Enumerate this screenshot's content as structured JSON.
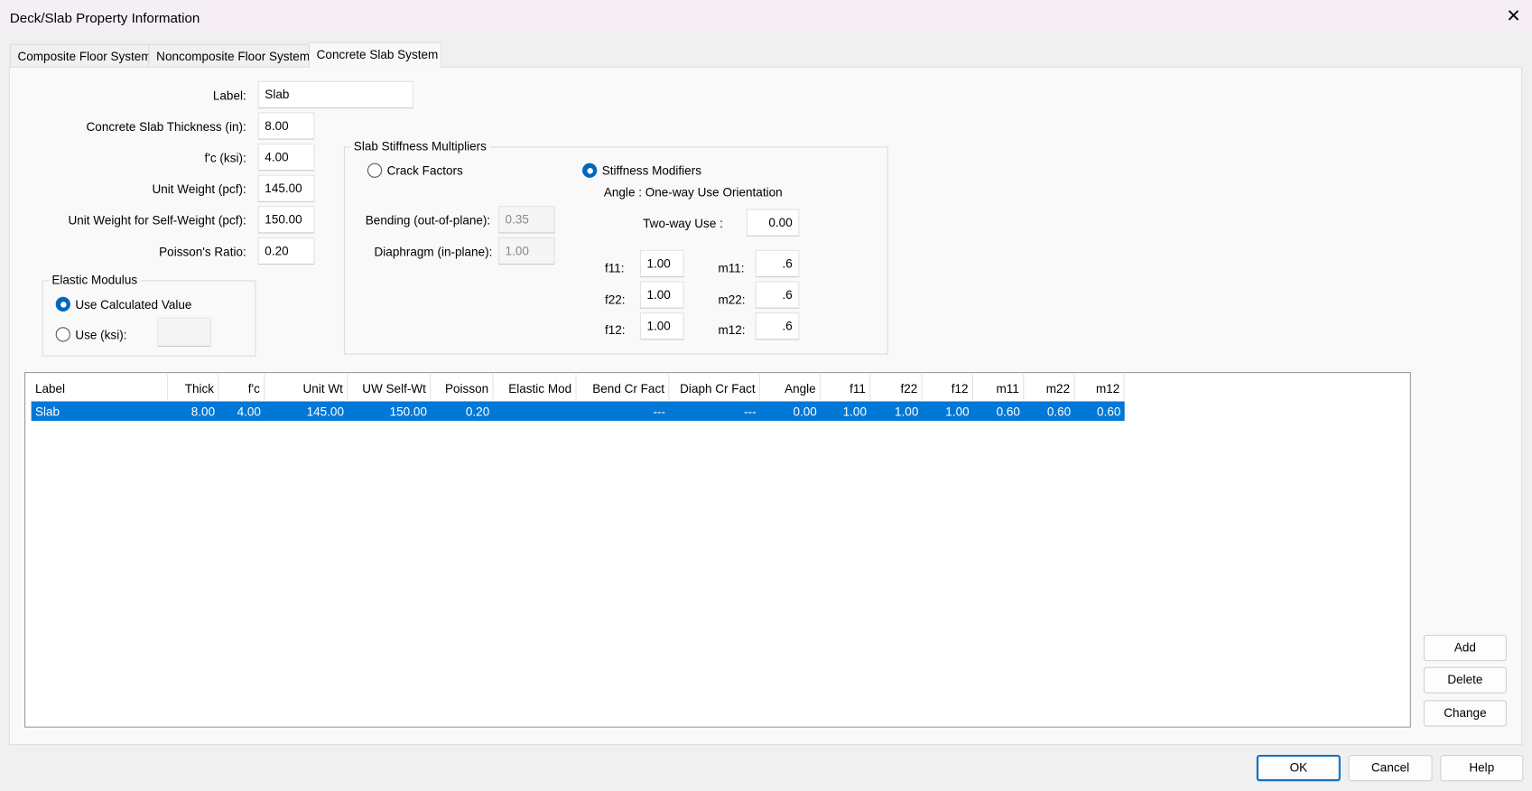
{
  "window": {
    "title": "Deck/Slab Property Information"
  },
  "tabs": [
    {
      "label": "Composite Floor System"
    },
    {
      "label": "Noncomposite Floor System"
    },
    {
      "label": "Concrete Slab System"
    }
  ],
  "form": {
    "label": {
      "label": "Label:",
      "value": "Slab"
    },
    "thickness": {
      "label": "Concrete Slab Thickness  (in):",
      "value": "8.00"
    },
    "fc": {
      "label": "f'c (ksi):",
      "value": "4.00"
    },
    "unit_weight": {
      "label": "Unit Weight (pcf):",
      "value": "145.00"
    },
    "unit_weight_self": {
      "label": "Unit Weight for Self-Weight (pcf):",
      "value": "150.00"
    },
    "poisson": {
      "label": "Poisson's Ratio:",
      "value": "0.20"
    }
  },
  "elastic_modulus": {
    "title": "Elastic Modulus",
    "use_calculated": "Use Calculated Value",
    "use_ksi": "Use (ksi):",
    "ksi_value": ""
  },
  "stiffness": {
    "title": "Slab Stiffness Multipliers",
    "crack_factors": "Crack Factors",
    "stiffness_modifiers": "Stiffness Modifiers",
    "angle_label": "Angle : One-way Use Orientation",
    "two_way_label": "Two-way Use :",
    "two_way_value": "0.00",
    "bending_label": "Bending (out-of-plane):",
    "bending_value": "0.35",
    "diaphragm_label": "Diaphragm (in-plane):",
    "diaphragm_value": "1.00",
    "f11_label": "f11:",
    "f11": "1.00",
    "f22_label": "f22:",
    "f22": "1.00",
    "f12_label": "f12:",
    "f12": "1.00",
    "m11_label": "m11:",
    "m11": ".6",
    "m22_label": "m22:",
    "m22": ".6",
    "m12_label": "m12:",
    "m12": ".6"
  },
  "table": {
    "headers": [
      "Label",
      "Thick",
      "f'c",
      "Unit Wt",
      "UW Self-Wt",
      "Poisson",
      "Elastic Mod",
      "Bend Cr Fact",
      "Diaph Cr Fact",
      "Angle",
      "f11",
      "f22",
      "f12",
      "m11",
      "m22",
      "m12"
    ],
    "rows": [
      [
        "Slab",
        "8.00",
        "4.00",
        "145.00",
        "150.00",
        "0.20",
        "",
        "---",
        "---",
        "0.00",
        "1.00",
        "1.00",
        "1.00",
        "0.60",
        "0.60",
        "0.60"
      ]
    ]
  },
  "buttons": {
    "add": "Add",
    "delete": "Delete",
    "change": "Change",
    "ok": "OK",
    "cancel": "Cancel",
    "help": "Help"
  },
  "colors": {
    "selection": "#0078d7",
    "accent": "#0067c0"
  }
}
